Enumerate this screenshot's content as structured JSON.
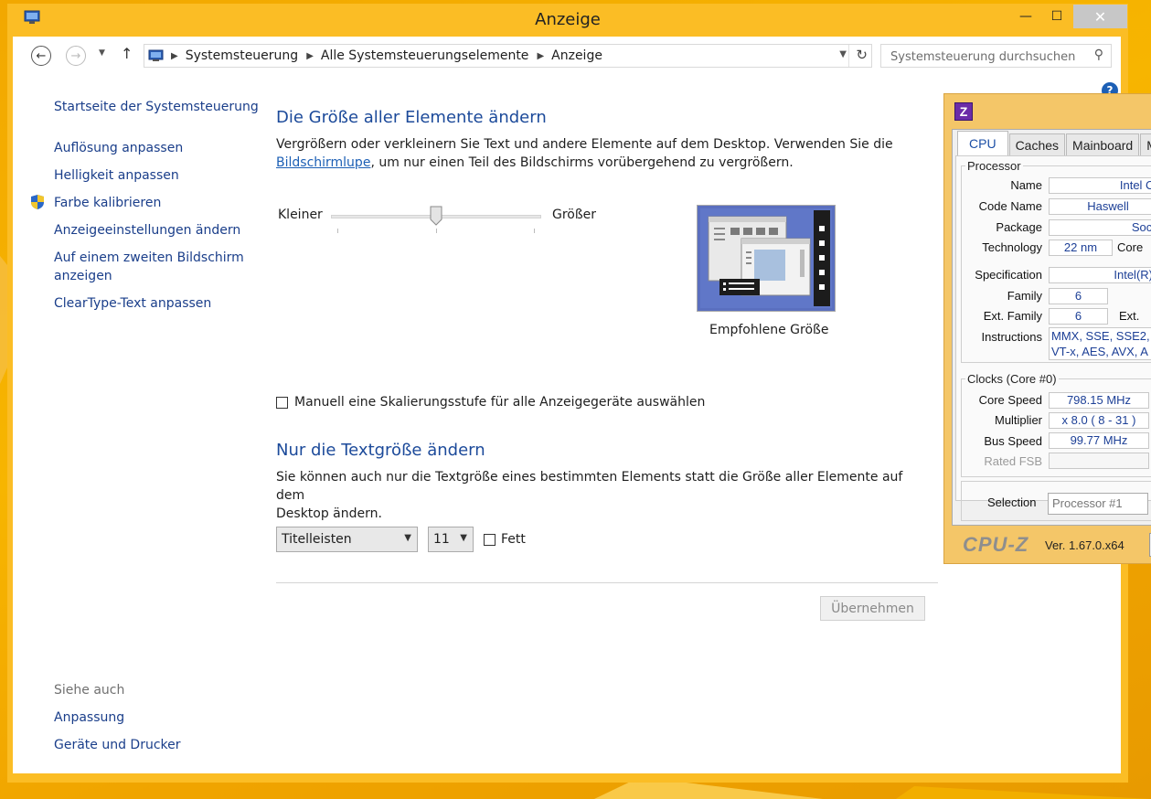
{
  "window": {
    "title": "Anzeige",
    "close_glyph": "✕",
    "minimize_glyph": "—",
    "maximize_glyph": "☐"
  },
  "address": {
    "crumbs": [
      "Systemsteuerung",
      "Alle Systemsteuerungselemente",
      "Anzeige"
    ],
    "search_placeholder": "Systemsteuerung durchsuchen"
  },
  "sidebar": {
    "home": "Startseite der Systemsteuerung",
    "items": [
      "Auflösung anpassen",
      "Helligkeit anpassen",
      "Farbe kalibrieren",
      "Anzeigeeinstellungen ändern",
      "Auf einem zweiten Bildschirm",
      "anzeigen",
      "ClearType-Text anpassen"
    ],
    "see_also": "Siehe auch",
    "see_also_items": [
      "Anpassung",
      "Geräte und Drucker"
    ]
  },
  "main": {
    "section1_title": "Die Größe aller Elemente ändern",
    "section1_text_a": "Vergrößern oder verkleinern Sie Text und andere Elemente auf dem Desktop. Verwenden Sie die",
    "section1_link": "Bildschirmlupe",
    "section1_text_b": ", um nur einen Teil des Bildschirms vorübergehend zu vergrößern.",
    "slider_min_label": "Kleiner",
    "slider_max_label": "Größer",
    "slider_value": 0.5,
    "preview_caption": "Empfohlene Größe",
    "manual_scaling_label": "Manuell eine Skalierungsstufe für alle Anzeigegeräte auswählen",
    "manual_scaling_checked": false,
    "section2_title": "Nur die Textgröße ändern",
    "section2_text_a": "Sie können auch nur die Textgröße eines bestimmten Elements statt die Größe aller Elemente auf dem",
    "section2_text_b": "Desktop ändern.",
    "element_select": "Titelleisten",
    "size_select": "11",
    "bold_label": "Fett",
    "bold_checked": false,
    "apply_label": "Übernehmen"
  },
  "cpuz": {
    "tabs": [
      "CPU",
      "Caches",
      "Mainboard",
      "Me"
    ],
    "processor_group": "Processor",
    "name_label": "Name",
    "name_value": "Intel Cor",
    "codename_label": "Code Name",
    "codename_value": "Haswell",
    "package_label": "Package",
    "package_value": "Socke",
    "technology_label": "Technology",
    "technology_value": "22 nm",
    "core_label": "Core",
    "specification_label": "Specification",
    "specification_value": "Intel(R) C",
    "family_label": "Family",
    "family_value": "6",
    "extfamily_label": "Ext. Family",
    "extfamily_value": "6",
    "ext_label": "Ext.",
    "instructions_label": "Instructions",
    "instructions_line1": "MMX, SSE, SSE2,",
    "instructions_line2": "VT-x, AES, AVX, A",
    "clocks_group": "Clocks (Core #0)",
    "corespeed_label": "Core Speed",
    "corespeed_value": "798.15 MHz",
    "multiplier_label": "Multiplier",
    "multiplier_value": "x 8.0 ( 8 - 31 )",
    "busspeed_label": "Bus Speed",
    "busspeed_value": "99.77 MHz",
    "ratedfsb_label": "Rated FSB",
    "selection_label": "Selection",
    "selection_value": "Processor #1",
    "brand": "CPU-Z",
    "version": "Ver. 1.67.0.x64"
  }
}
